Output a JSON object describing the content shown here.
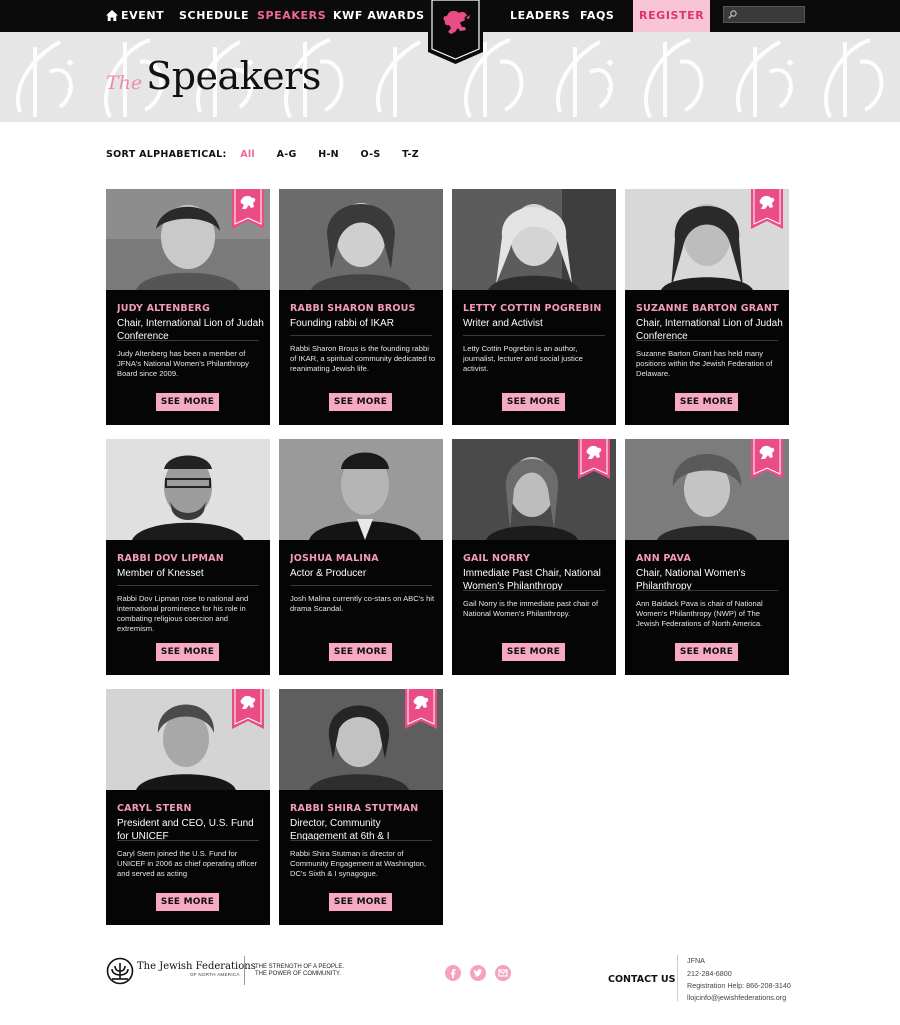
{
  "nav": {
    "items": [
      {
        "label": "EVENT",
        "active": false
      },
      {
        "label": "SCHEDULE",
        "active": false
      },
      {
        "label": "SPEAKERS",
        "active": true
      },
      {
        "label": "KWF AWARDS",
        "active": false
      },
      {
        "label": "LEADERS",
        "active": false
      },
      {
        "label": "FAQS",
        "active": false
      },
      {
        "label": "REGISTER",
        "active": false
      }
    ],
    "search": {
      "value": "",
      "placeholder": ""
    },
    "colors": {
      "bar": "#0b0b0b",
      "accent": "#f2659a",
      "register_bg": "#f7c5d6"
    }
  },
  "header": {
    "title_prefix": "The",
    "title": "Speakers"
  },
  "sort": {
    "label": "SORT ALPHABETICAL:",
    "options": [
      {
        "label": "All",
        "active": true
      },
      {
        "label": "A-G",
        "active": false
      },
      {
        "label": "H-N",
        "active": false
      },
      {
        "label": "O-S",
        "active": false
      },
      {
        "label": "T-Z",
        "active": false
      }
    ]
  },
  "speakers": [
    {
      "name": "JUDY ALTENBERG",
      "role": "Chair, International Lion of Judah Conference",
      "description": "Judy Altenberg has been a member of JFNA's National Women's Philanthropy Board since 2009.",
      "ribbon": true,
      "button": "SEE MORE"
    },
    {
      "name": "RABBI SHARON BROUS",
      "role": "Founding rabbi of IKAR",
      "description": "Rabbi Sharon Brous is the founding rabbi of IKAR, a spiritual community dedicated to reanimating Jewish life.",
      "ribbon": false,
      "button": "SEE MORE"
    },
    {
      "name": "LETTY COTTIN POGREBIN",
      "role": "Writer and Activist",
      "description": "Letty Cottin Pogrebin is an author, journalist, lecturer and social justice activist.",
      "ribbon": false,
      "button": "SEE MORE"
    },
    {
      "name": "SUZANNE BARTON GRANT",
      "role": "Chair, International Lion of Judah Conference",
      "description": "Suzanne Barton Grant has held many positions within the Jewish Federation of Delaware.",
      "ribbon": true,
      "button": "SEE MORE"
    },
    {
      "name": "RABBI DOV LIPMAN",
      "role": "Member of Knesset",
      "description": "Rabbi Dov Lipman rose to national and international prominence for his role in combating religious coercion and extremism.",
      "ribbon": false,
      "button": "SEE MORE"
    },
    {
      "name": "JOSHUA MALINA",
      "role": "Actor & Producer",
      "description": "Josh Malina currently co-stars on ABC's hit drama Scandal.",
      "ribbon": false,
      "button": "SEE MORE"
    },
    {
      "name": "GAIL NORRY",
      "role": "Immediate Past Chair, National Women's Philanthropy",
      "description": "Gail Norry is the immediate past chair of National Women's Philanthropy.",
      "ribbon": true,
      "button": "SEE MORE"
    },
    {
      "name": "ANN PAVA",
      "role": "Chair, National Women's Philanthropy",
      "description": "Ann Baidack Pava is chair of National Women's Philanthropy (NWP) of The Jewish Federations of North America.",
      "ribbon": true,
      "button": "SEE MORE"
    },
    {
      "name": "CARYL STERN",
      "role": "President and CEO, U.S. Fund for UNICEF",
      "description": "Caryl Stern joined the U.S. Fund for UNICEF in 2006 as chief operating officer and served as acting",
      "ribbon": true,
      "button": "SEE MORE"
    },
    {
      "name": "RABBI SHIRA STUTMAN",
      "role": "Director, Community Engagement at 6th & I",
      "description": "Rabbi Shira Stutman is director of Community Engagement at Washington, DC's Sixth & I synagogue.",
      "ribbon": true,
      "button": "SEE MORE"
    }
  ],
  "footer": {
    "org_name": "The Jewish Federations",
    "org_sub": "OF NORTH AMERICA",
    "tagline_1": "THE STRENGTH OF A PEOPLE.",
    "tagline_2": "THE POWER OF COMMUNITY.",
    "social": [
      "facebook-icon",
      "twitter-icon",
      "email-icon"
    ],
    "contact_label": "CONTACT US",
    "contact_lines": [
      "JFNA",
      "212-284-6800",
      "Registration Help: 866-208-3140",
      "llojcinfo@jewishfederations.org"
    ]
  }
}
